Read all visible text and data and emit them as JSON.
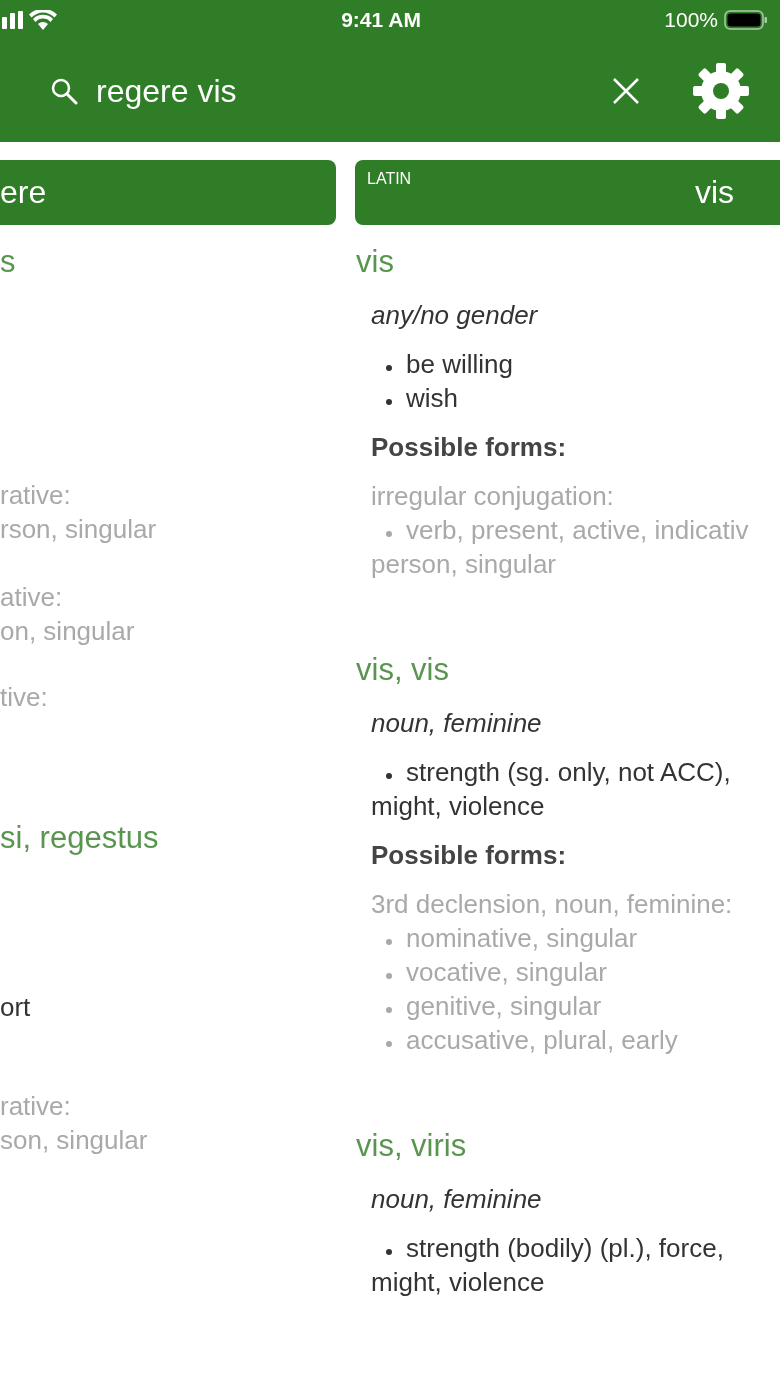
{
  "status_bar": {
    "time": "9:41 AM",
    "battery": "100%"
  },
  "search": {
    "value": "regere vis"
  },
  "left_column": {
    "card_title": "ere",
    "lines": [
      {
        "kind": "heading",
        "text": "s"
      },
      {
        "kind": "form",
        "text": "rative:"
      },
      {
        "kind": "form",
        "text": "rson, singular"
      },
      {
        "kind": "form",
        "text": "ative:"
      },
      {
        "kind": "form",
        "text": "on, singular"
      },
      {
        "kind": "form",
        "text": "tive:"
      },
      {
        "kind": "heading",
        "text": "si, regestus"
      },
      {
        "kind": "sense",
        "text": "ort"
      },
      {
        "kind": "form",
        "text": "rative:"
      },
      {
        "kind": "form",
        "text": "son, singular"
      }
    ]
  },
  "right_column": {
    "card_label": "LATIN",
    "card_title": "vis",
    "entries": [
      {
        "heading": "vis",
        "grammar": "any/no gender",
        "senses": [
          {
            "lines": [
              "be willing"
            ]
          },
          {
            "lines": [
              "wish"
            ]
          }
        ],
        "forms_title": "Possible forms:",
        "form_groups": [
          {
            "title": "irregular conjugation:",
            "items": [
              {
                "lines": [
                  "verb, present, active, indicativ",
                  "person, singular"
                ]
              }
            ]
          }
        ]
      },
      {
        "heading": "vis, vis",
        "grammar": "noun, feminine",
        "senses": [
          {
            "lines": [
              "strength (sg. only, not ACC),",
              "might, violence"
            ]
          }
        ],
        "forms_title": "Possible forms:",
        "form_groups": [
          {
            "title": "3rd declension, noun, feminine:",
            "items": [
              {
                "lines": [
                  "nominative, singular"
                ]
              },
              {
                "lines": [
                  "vocative, singular"
                ]
              },
              {
                "lines": [
                  "genitive, singular"
                ]
              },
              {
                "lines": [
                  "accusative, plural, early"
                ]
              }
            ]
          }
        ]
      },
      {
        "heading": "vis, viris",
        "grammar": "noun, feminine",
        "senses": [
          {
            "lines": [
              "strength (bodily) (pl.), force,",
              "might, violence"
            ]
          }
        ]
      }
    ]
  }
}
